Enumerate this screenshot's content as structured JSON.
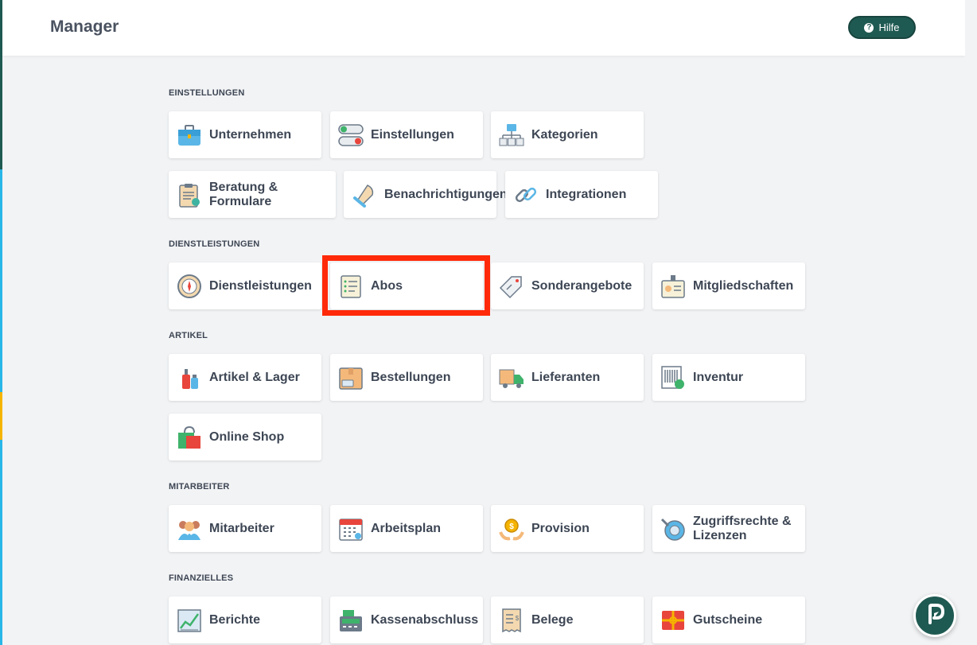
{
  "header": {
    "title": "Manager",
    "help_label": "Hilfe"
  },
  "sections": {
    "einstellungen": "EINSTELLUNGEN",
    "dienstleistungen": "DIENSTLEISTUNGEN",
    "artikel": "ARTIKEL",
    "mitarbeiter": "MITARBEITER",
    "finanzielles": "FINANZIELLES"
  },
  "cards": {
    "unternehmen": "Unternehmen",
    "einstellungen": "Einstellungen",
    "kategorien": "Kategorien",
    "beratung": "Beratung & Formulare",
    "benachrichtigungen": "Benachrichtigungen",
    "integrationen": "Integrationen",
    "dienstleistungen": "Dienstleistungen",
    "abos": "Abos",
    "sonderangebote": "Sonderangebote",
    "mitgliedschaften": "Mitgliedschaften",
    "artikel_lager": "Artikel & Lager",
    "bestellungen": "Bestellungen",
    "lieferanten": "Lieferanten",
    "inventur": "Inventur",
    "online_shop": "Online Shop",
    "mitarbeiter": "Mitarbeiter",
    "arbeitsplan": "Arbeitsplan",
    "provision": "Provision",
    "zugriffsrechte": "Zugriffsrechte & Lizenzen",
    "berichte": "Berichte",
    "kassenabschluss": "Kassenabschluss",
    "belege": "Belege",
    "gutscheine": "Gutscheine"
  },
  "colors": {
    "brand": "#1f5a52",
    "highlight": "#ff2a0a",
    "background": "#f2f3f5"
  }
}
